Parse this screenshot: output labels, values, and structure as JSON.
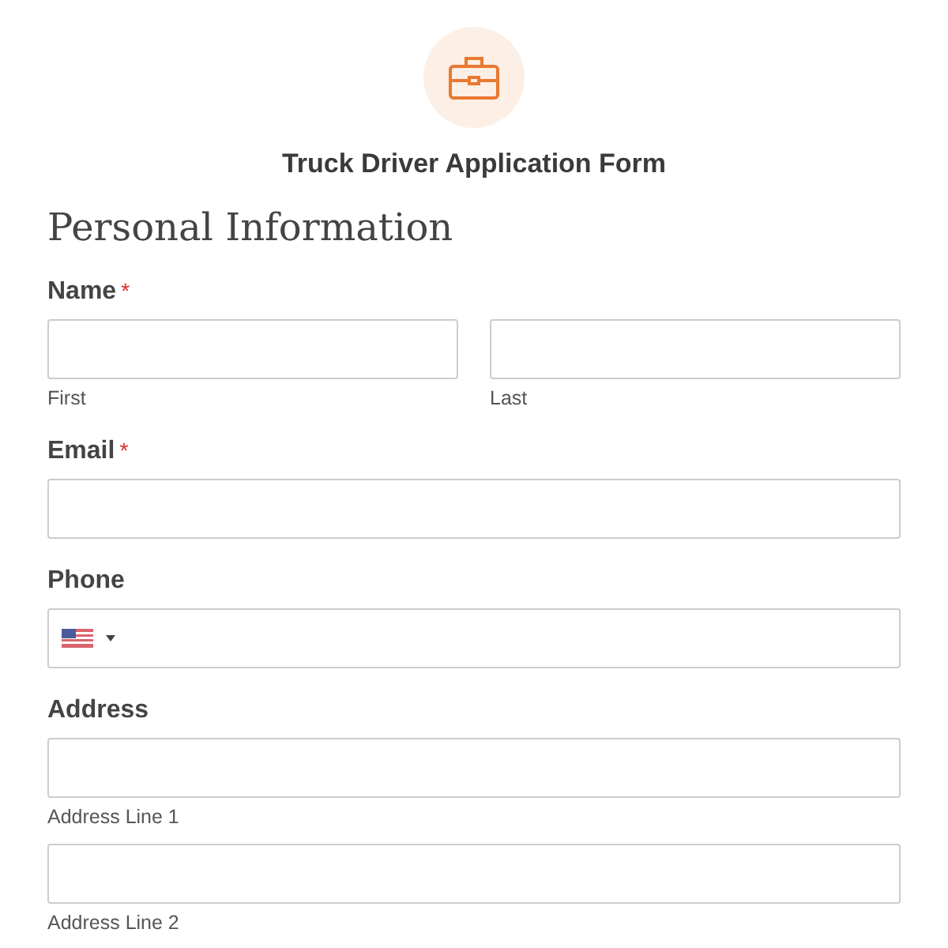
{
  "form": {
    "title": "Truck Driver Application Form"
  },
  "section": {
    "heading": "Personal Information"
  },
  "fields": [
    {
      "kind": "name",
      "label": "Name",
      "required_mark": "*",
      "inputs": [
        {
          "sublabel": "First"
        },
        {
          "sublabel": "Last"
        }
      ]
    },
    {
      "kind": "text",
      "label": "Email",
      "required_mark": "*"
    },
    {
      "kind": "phone",
      "label": "Phone"
    },
    {
      "kind": "address",
      "label": "Address",
      "inputs": [
        {
          "sublabel": "Address Line 1"
        },
        {
          "sublabel": "Address Line 2"
        }
      ]
    }
  ]
}
